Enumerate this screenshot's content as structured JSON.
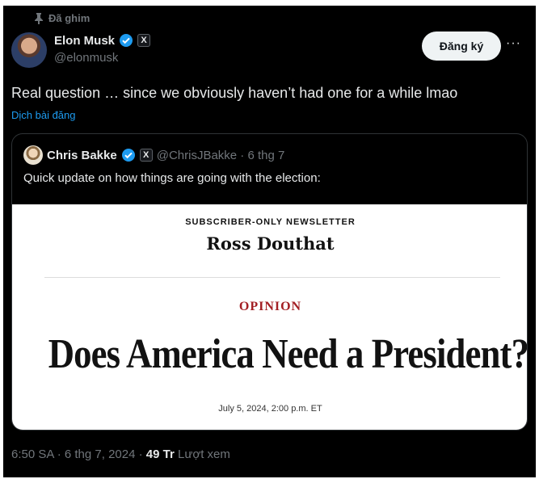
{
  "pinned_label": "Đã ghim",
  "author": {
    "name": "Elon Musk",
    "handle": "@elonmusk",
    "badge": "X"
  },
  "subscribe_label": "Đăng ký",
  "more_label": "···",
  "tweet_text": "Real question … since we obviously haven’t had one for a while lmao",
  "translate_label": "Dịch bài đăng",
  "quote": {
    "name": "Chris Bakke",
    "badge": "X",
    "meta": "@ChrisJBakke · 6 thg 7",
    "text": "Quick update on how things are going with the election:",
    "card": {
      "kicker": "SUBSCRIBER-ONLY NEWSLETTER",
      "author": "Ross Douthat",
      "section": "OPINION",
      "headline": "Does America Need a President?",
      "date": "July 5, 2024, 2:00 p.m. ET"
    }
  },
  "footer": {
    "time": "6:50 SA · 6 thg 7, 2024 · ",
    "views_count": "49 Tr",
    "views_label": " Lượt xem"
  },
  "colors": {
    "accent": "#1d9bf0",
    "background": "#000000",
    "opinion_red": "#a31f24"
  }
}
